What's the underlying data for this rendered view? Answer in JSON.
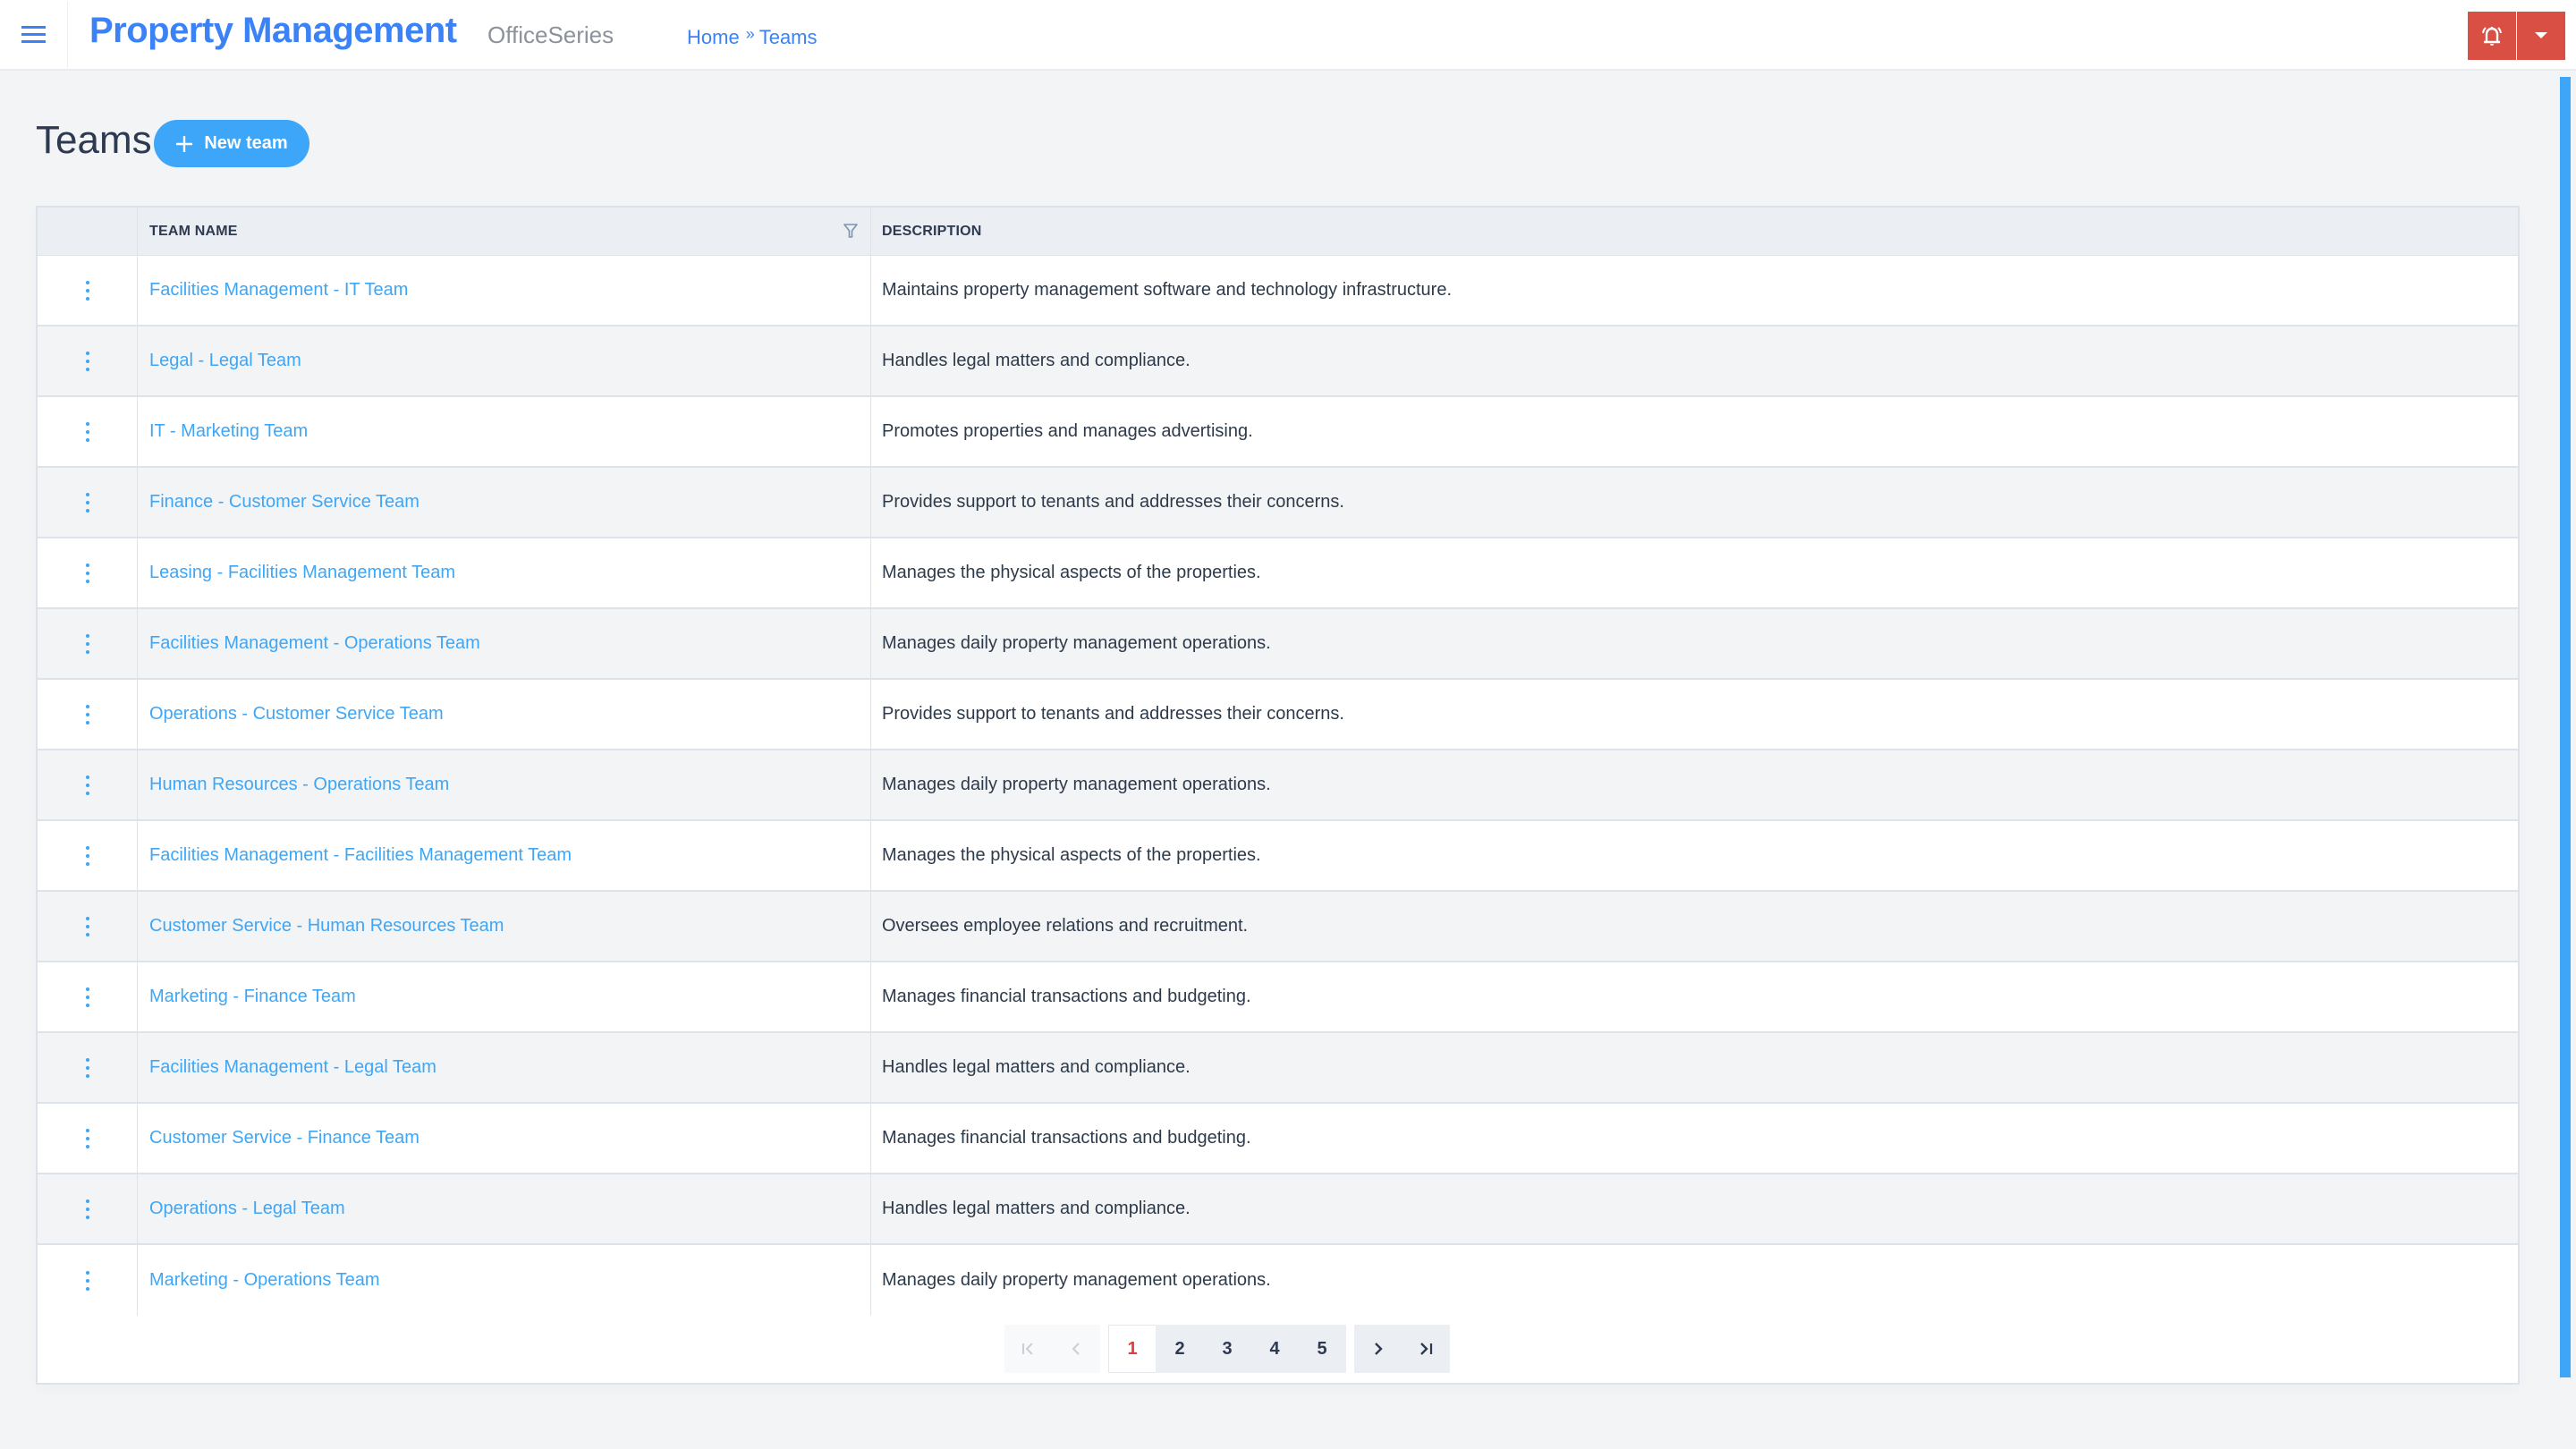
{
  "header": {
    "app_title": "Property Management",
    "app_subtitle": "OfficeSeries",
    "breadcrumb": {
      "home": "Home",
      "separator": "»",
      "current": "Teams"
    },
    "icons": {
      "menu": "hamburger-menu-icon",
      "alert": "bell-ringing-icon",
      "dropdown": "caret-down-icon"
    },
    "colors": {
      "brand": "#3b82f6",
      "alert_button": "#d94f43"
    }
  },
  "page": {
    "title": "Teams",
    "new_team_button": "New team",
    "accent_color": "#3ea6f8"
  },
  "table": {
    "columns": {
      "actions": "",
      "team_name": "TEAM NAME",
      "description": "DESCRIPTION"
    },
    "rows": [
      {
        "team_name": "Facilities Management - IT Team",
        "description": "Maintains property management software and technology infrastructure."
      },
      {
        "team_name": "Legal - Legal Team",
        "description": "Handles legal matters and compliance."
      },
      {
        "team_name": "IT - Marketing Team",
        "description": "Promotes properties and manages advertising."
      },
      {
        "team_name": "Finance - Customer Service Team",
        "description": "Provides support to tenants and addresses their concerns."
      },
      {
        "team_name": "Leasing - Facilities Management Team",
        "description": "Manages the physical aspects of the properties."
      },
      {
        "team_name": "Facilities Management - Operations Team",
        "description": "Manages daily property management operations."
      },
      {
        "team_name": "Operations - Customer Service Team",
        "description": "Provides support to tenants and addresses their concerns."
      },
      {
        "team_name": "Human Resources - Operations Team",
        "description": "Manages daily property management operations."
      },
      {
        "team_name": "Facilities Management - Facilities Management Team",
        "description": "Manages the physical aspects of the properties."
      },
      {
        "team_name": "Customer Service - Human Resources Team",
        "description": "Oversees employee relations and recruitment."
      },
      {
        "team_name": "Marketing - Finance Team",
        "description": "Manages financial transactions and budgeting."
      },
      {
        "team_name": "Facilities Management - Legal Team",
        "description": "Handles legal matters and compliance."
      },
      {
        "team_name": "Customer Service - Finance Team",
        "description": "Manages financial transactions and budgeting."
      },
      {
        "team_name": "Operations - Legal Team",
        "description": "Handles legal matters and compliance."
      },
      {
        "team_name": "Marketing - Operations Team",
        "description": "Manages daily property management operations."
      }
    ]
  },
  "pagination": {
    "first": "first-page-icon",
    "prev": "previous-page-icon",
    "pages": [
      "1",
      "2",
      "3",
      "4",
      "5"
    ],
    "current_page": "1",
    "next": "next-page-icon",
    "last": "last-page-icon",
    "first_disabled": true,
    "prev_disabled": true
  }
}
